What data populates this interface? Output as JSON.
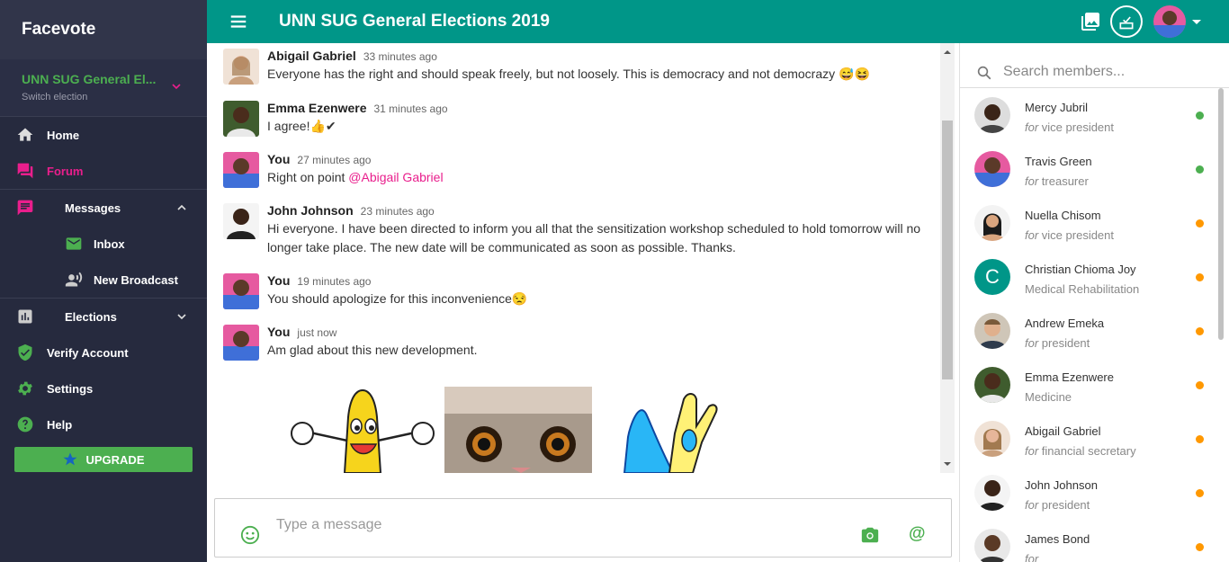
{
  "brand": "Facevote",
  "election": {
    "name": "UNN SUG General El...",
    "sub": "Switch election"
  },
  "nav": {
    "home": "Home",
    "forum": "Forum",
    "messages": "Messages",
    "inbox": "Inbox",
    "broadcast": "New Broadcast",
    "elections": "Elections",
    "verify": "Verify Account",
    "settings": "Settings",
    "help": "Help",
    "upgrade": "UPGRADE"
  },
  "topbar": {
    "title": "UNN SUG General Elections 2019"
  },
  "messages": [
    {
      "name": "Abigail Gabriel",
      "time": "33 minutes ago",
      "text": "Everyone has the right and should speak freely, but not loosely. This is democracy and not democrazy 😅😆"
    },
    {
      "name": "Emma Ezenwere",
      "time": "31 minutes ago",
      "text": "I agree!👍✔"
    },
    {
      "name": "You",
      "time": "27 minutes ago",
      "text": "Right on point ",
      "mention": "@Abigail Gabriel"
    },
    {
      "name": "John Johnson",
      "time": "23 minutes ago",
      "text": "Hi everyone. I have been directed to inform you all that the sensitization workshop scheduled to hold tomorrow will no longer take place. The new date will be communicated as soon as possible. Thanks."
    },
    {
      "name": "You",
      "time": "19 minutes ago",
      "text": "You should apologize for this inconvenience😒"
    },
    {
      "name": "You",
      "time": "just now",
      "text": "Am glad about this new development."
    }
  ],
  "composer": {
    "placeholder": "Type a message"
  },
  "members_search": {
    "placeholder": "Search members..."
  },
  "members": [
    {
      "name": "Mercy Jubril",
      "for": "for",
      "role": "vice president",
      "status": "online",
      "color": "#4caf50"
    },
    {
      "name": "Travis Green",
      "for": "for",
      "role": "treasurer",
      "status": "online",
      "color": "#4caf50"
    },
    {
      "name": "Nuella Chisom",
      "for": "for",
      "role": "vice president",
      "status": "away",
      "color": "#ff9800"
    },
    {
      "name": "Christian Chioma Joy",
      "for": "",
      "role": "Medical Rehabilitation",
      "status": "away",
      "color": "#ff9800",
      "initial": "C"
    },
    {
      "name": "Andrew Emeka",
      "for": "for",
      "role": "president",
      "status": "away",
      "color": "#ff9800"
    },
    {
      "name": "Emma Ezenwere",
      "for": "",
      "role": "Medicine",
      "status": "away",
      "color": "#ff9800"
    },
    {
      "name": "Abigail Gabriel",
      "for": "for",
      "role": "financial secretary",
      "status": "away",
      "color": "#ff9800"
    },
    {
      "name": "John Johnson",
      "for": "for",
      "role": "president",
      "status": "away",
      "color": "#ff9800"
    },
    {
      "name": "James Bond",
      "for": "for",
      "role": "",
      "status": "away",
      "color": "#ff9800"
    }
  ],
  "colors": {
    "primary": "#009688",
    "accent": "#4caf50",
    "sidebar": "#262a3e",
    "forum_active": "#e91e8c"
  }
}
